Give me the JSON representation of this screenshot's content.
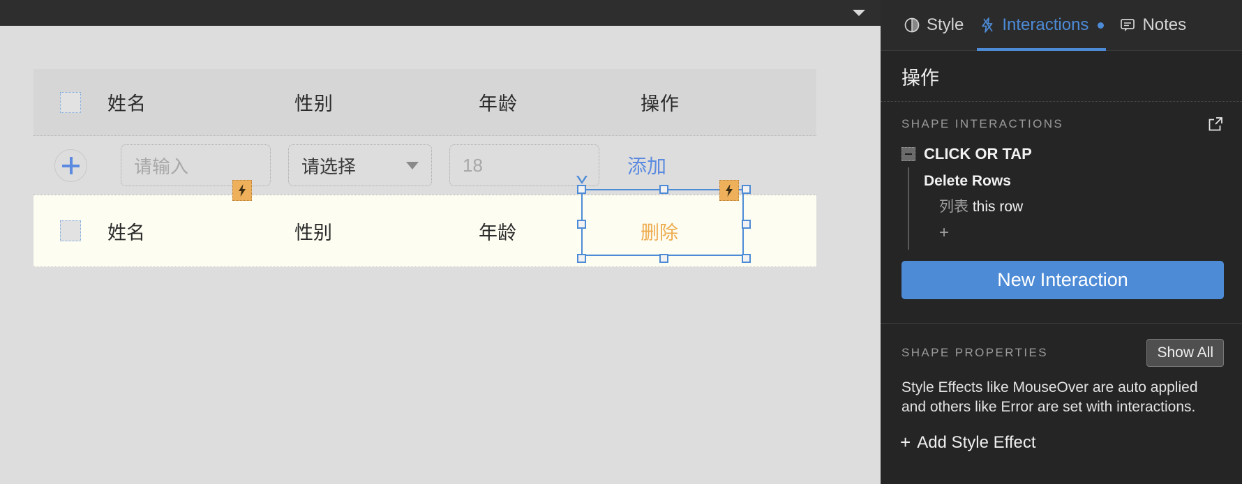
{
  "canvas": {
    "topbar": {
      "chevron_icon": "chevron-down-icon"
    },
    "table": {
      "header": {
        "checkbox_icon": "checkbox-unchecked-icon",
        "columns": [
          "姓名",
          "性别",
          "年龄",
          "操作"
        ]
      },
      "input_row": {
        "add_icon": "plus-circle-icon",
        "name_placeholder": "请输入",
        "gender_value": "请选择",
        "gender_caret_icon": "caret-down-icon",
        "age_placeholder": "18",
        "add_label": "添加"
      },
      "data_row": {
        "checkbox_icon": "checkbox-unchecked-icon",
        "cells": [
          "姓名",
          "性别",
          "年龄"
        ],
        "action_label": "删除"
      }
    },
    "badges": {
      "row_bolt_icon": "lightning-bolt-icon",
      "cell_bolt_icon": "lightning-bolt-icon"
    },
    "selection": {
      "rotate_handle_icon": "rotate-handle-icon",
      "handle_icon": "resize-handle-icon"
    }
  },
  "panel": {
    "tabs": [
      {
        "label": "Style",
        "icon": "style-droplet-icon",
        "active": false,
        "has_dot": false
      },
      {
        "label": "Interactions",
        "icon": "lightning-bolt-icon",
        "active": true,
        "has_dot": true
      },
      {
        "label": "Notes",
        "icon": "note-comment-icon",
        "active": false,
        "has_dot": false
      }
    ],
    "title": "操作",
    "shape_interactions": {
      "section_label": "SHAPE INTERACTIONS",
      "popout_icon": "open-external-icon",
      "collapse_icon": "collapse-minus-icon",
      "event": "CLICK OR TAP",
      "action": "Delete Rows",
      "target_object": "列表",
      "target_scope": "this row",
      "add_case_label": "+",
      "new_interaction_label": "New Interaction"
    },
    "shape_properties": {
      "section_label": "SHAPE PROPERTIES",
      "show_all_label": "Show All",
      "description": "Style Effects like MouseOver are auto applied and others like Error are set with interactions.",
      "add_style_plus": "+",
      "add_style_label": "Add Style Effect"
    }
  },
  "colors": {
    "accent_blue": "#4d8bd6",
    "badge_orange": "#eeb05a",
    "action_orange": "#eeab4e",
    "panel_bg": "#252525",
    "canvas_bg": "#dddddd",
    "row_highlight": "#fdfdf2"
  }
}
